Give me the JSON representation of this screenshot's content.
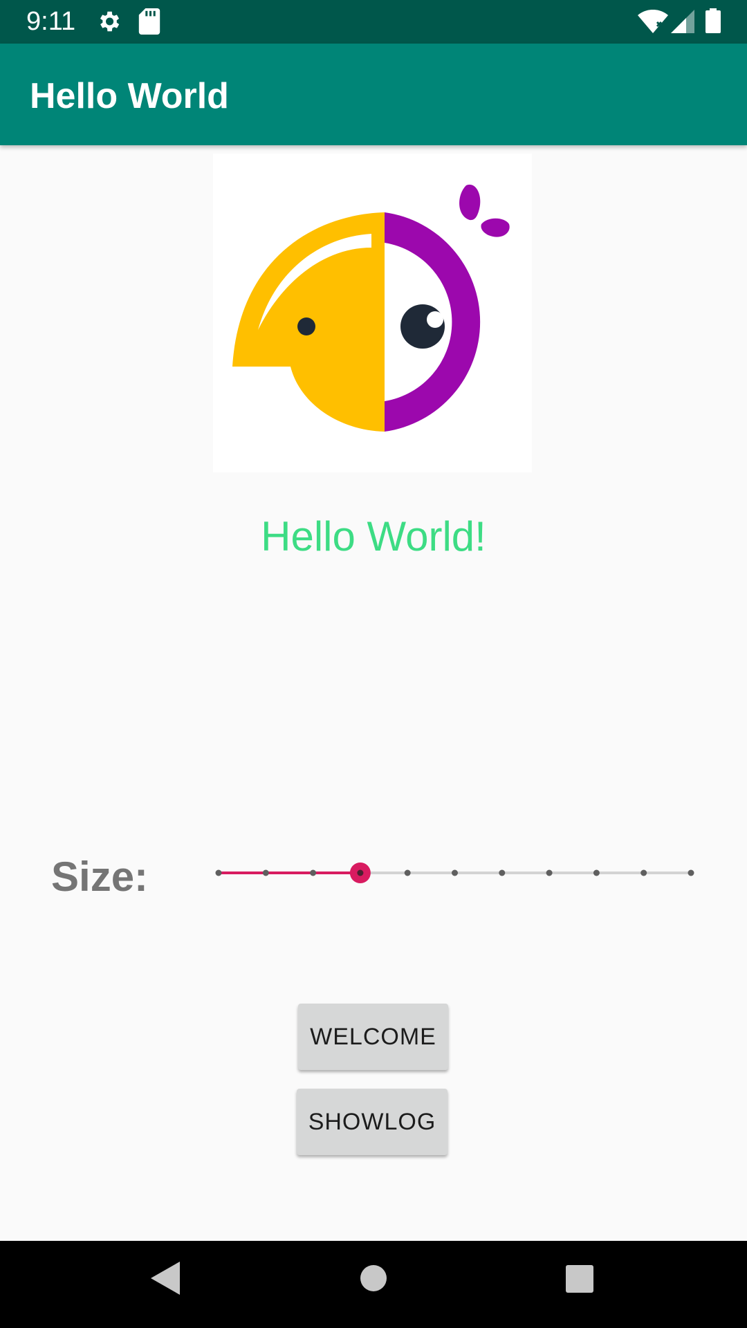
{
  "status_bar": {
    "time": "9:11",
    "left_icons": [
      "gear-icon",
      "sd-card-icon"
    ],
    "right_icons": [
      "wifi-icon",
      "signal-icon",
      "battery-icon"
    ],
    "background": "#00574b"
  },
  "app_bar": {
    "title": "Hello World",
    "background": "#008577"
  },
  "logo": {
    "icon": "parrot-logo-icon",
    "colors": {
      "yellow": "#ffbf00",
      "purple": "#9c08ad",
      "dark": "#1f2937"
    }
  },
  "main": {
    "greeting": "Hello World!",
    "greeting_color": "#3ddc84",
    "size_label": "Size:",
    "slider": {
      "steps": 11,
      "selected_index": 3,
      "accent_color": "#d81b60"
    },
    "buttons": {
      "welcome": "WELCOME",
      "showlog": "SHOWLOG"
    }
  },
  "nav_bar": {
    "items": [
      "back-icon",
      "home-icon",
      "recents-icon"
    ]
  }
}
